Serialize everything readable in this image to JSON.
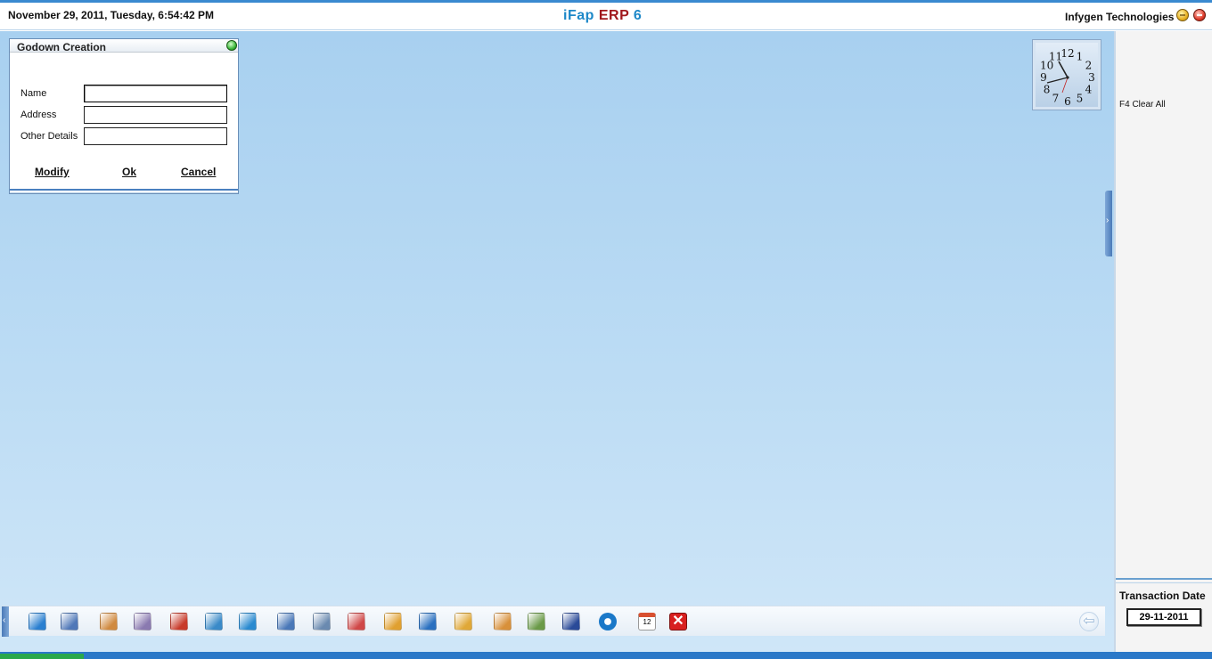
{
  "header": {
    "datetime": "November  29, 2011, Tuesday, 6:54:42 PM",
    "app_title_part1": "iFap",
    "app_title_part2": "ERP",
    "app_title_part3": "6",
    "company": "Infygen Technologies"
  },
  "dialog": {
    "title": "Godown Creation",
    "fields": [
      {
        "label": "Name",
        "value": ""
      },
      {
        "label": "Address",
        "value": ""
      },
      {
        "label": "Other Details",
        "value": ""
      }
    ],
    "buttons": {
      "modify": "Modify",
      "ok": "Ok",
      "cancel": "Cancel"
    }
  },
  "right_panel": {
    "clear_all": "F4 Clear All",
    "transaction_date_label": "Transaction Date",
    "transaction_date_value": "29-11-2011"
  },
  "clock": {
    "numerals": [
      "12",
      "1",
      "2",
      "3",
      "4",
      "5",
      "6",
      "7",
      "8",
      "9",
      "10",
      "11"
    ]
  },
  "taskbar": {
    "icons": [
      {
        "name": "ledger-icon",
        "color": "#2a7fd0"
      },
      {
        "name": "user-tool-icon",
        "color": "#5078b8"
      },
      {
        "name": "contacts-icon",
        "color": "#d08a40"
      },
      {
        "name": "network-icon",
        "color": "#8a7ab0"
      },
      {
        "name": "books-icon",
        "color": "#c83a2a"
      },
      {
        "name": "cart-icon",
        "color": "#3a8ac8"
      },
      {
        "name": "refresh-icon",
        "color": "#2a8ad0"
      },
      {
        "name": "window-icon",
        "color": "#4a78b8"
      },
      {
        "name": "document-icon",
        "color": "#6a8ab0"
      },
      {
        "name": "chart-icon",
        "color": "#d04848"
      },
      {
        "name": "tree-icon",
        "color": "#e0a030"
      },
      {
        "name": "arrows-icon",
        "color": "#2a70c0"
      },
      {
        "name": "box-icon",
        "color": "#e0a838"
      },
      {
        "name": "gauge-icon",
        "color": "#d8903a"
      },
      {
        "name": "sheet-icon",
        "color": "#6a9a48"
      },
      {
        "name": "save-check-icon",
        "color": "#2a4a98"
      },
      {
        "name": "settings-icon",
        "color": "#1a78c8"
      },
      {
        "name": "calendar-icon",
        "color": "#d85030"
      },
      {
        "name": "exit-icon",
        "color": "#d82020"
      }
    ],
    "calendar_day": "12"
  }
}
